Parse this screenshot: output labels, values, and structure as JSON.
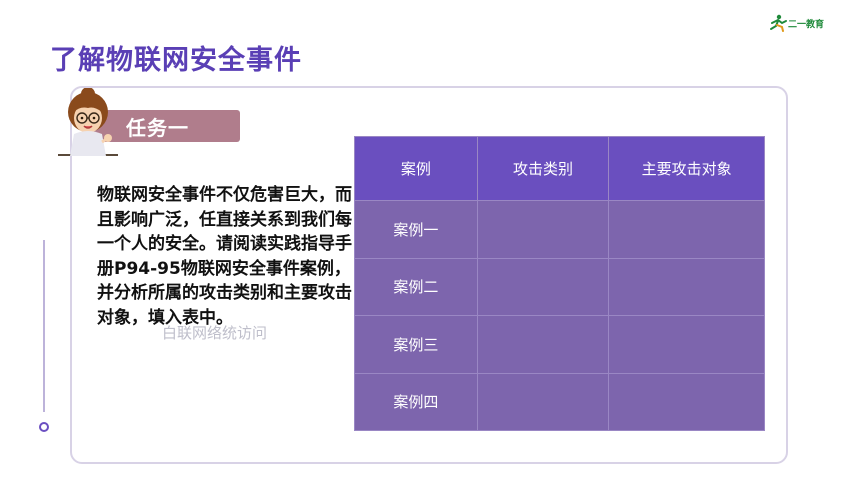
{
  "logo": {
    "text": "二一教育",
    "icon": "runner-logo-icon"
  },
  "title": "了解物联网安全事件",
  "task": {
    "label": "任务一",
    "avatar": "teacher-avatar"
  },
  "body": {
    "text": "物联网安全事件不仅危害巨大，而且影响广泛，任直接关系到我们每一个人的安全。请阅读实践指导手册P94-95物联网安全事件案例，并分析所属的攻击类别和主要攻击对象，填入表中。",
    "overlay": "白联网络统访问"
  },
  "table": {
    "headers": [
      "案例",
      "攻击类别",
      "主要攻击对象"
    ],
    "rows": [
      [
        "案例一",
        "",
        ""
      ],
      [
        "案例二",
        "",
        ""
      ],
      [
        "案例三",
        "",
        ""
      ],
      [
        "案例四",
        "",
        ""
      ]
    ]
  },
  "colors": {
    "title": "#5a3fb5",
    "tag": "#b07d8c",
    "table_header": "#6a4fbf",
    "table_body": "#7d65ad",
    "card_border": "#d8d2e6"
  }
}
